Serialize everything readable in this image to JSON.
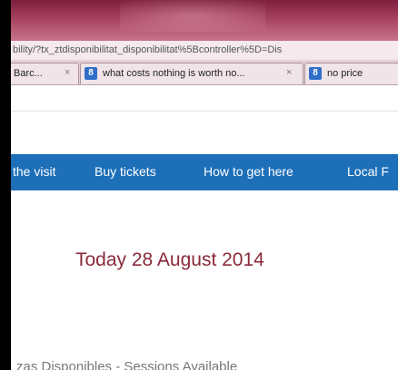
{
  "address_bar": {
    "url": "bility/?tx_ztdisponibilitat_disponibilitat%5Bcontroller%5D=Dis"
  },
  "tabs": [
    {
      "label": "Barc...",
      "close": "×",
      "icon": ""
    },
    {
      "label": "what costs nothing is worth no...",
      "close": "×",
      "icon": "google-icon",
      "icon_glyph": "8"
    },
    {
      "label": "no price",
      "icon": "google-icon",
      "icon_glyph": "8"
    }
  ],
  "nav": {
    "items": [
      "the visit",
      "Buy tickets",
      "How to get here",
      "Local F"
    ],
    "color": "#1d6fb8"
  },
  "main": {
    "date_title": "Today 28 August 2014",
    "sessions_label": "zas Disponibles - Sessions Available"
  },
  "colors": {
    "titlebar": "#a23d5b",
    "date_text": "#8a2a3a",
    "tab_icon": "#2f6fc9"
  }
}
